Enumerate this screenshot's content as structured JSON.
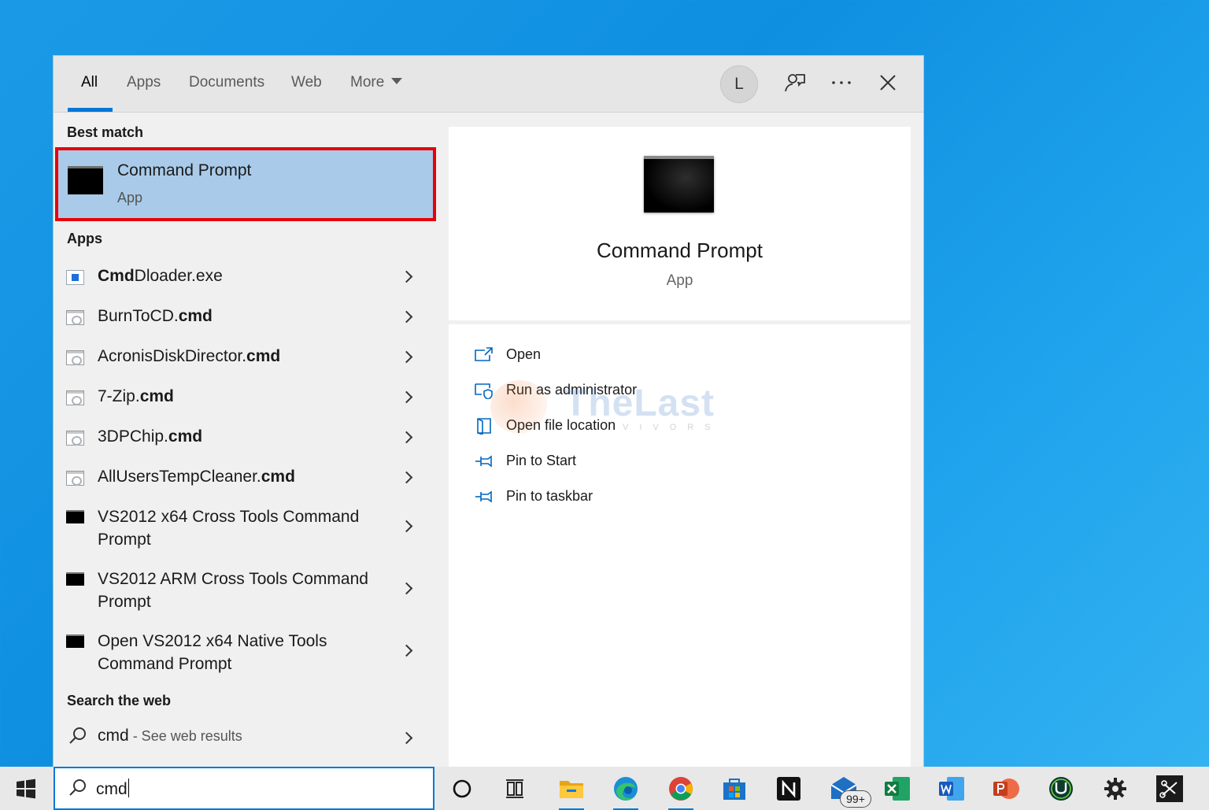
{
  "tabs": [
    {
      "label": "All",
      "active": true
    },
    {
      "label": "Apps",
      "active": false
    },
    {
      "label": "Documents",
      "active": false
    },
    {
      "label": "Web",
      "active": false
    },
    {
      "label": "More",
      "active": false
    }
  ],
  "header": {
    "avatar_letter": "L",
    "icons": [
      "feedback-icon",
      "more-options-icon",
      "close-icon"
    ]
  },
  "best_match": {
    "heading": "Best match",
    "title": "Command Prompt",
    "subtitle": "App",
    "icon": "terminal-icon",
    "highlight_color": "#e8000b"
  },
  "apps": {
    "heading": "Apps",
    "items": [
      {
        "prefix": "Cmd",
        "rest": "Dloader.exe",
        "icon": "exe-icon"
      },
      {
        "prefix": "BurnToCD.",
        "rest": "cmd",
        "icon": "cmd-file-icon"
      },
      {
        "prefix": "AcronisDiskDirector.",
        "rest": "cmd",
        "icon": "cmd-file-icon"
      },
      {
        "prefix": "7-Zip.",
        "rest": "cmd",
        "icon": "cmd-file-icon"
      },
      {
        "prefix": "3DPChip.",
        "rest": "cmd",
        "icon": "cmd-file-icon"
      },
      {
        "prefix": "AllUsersTempCleaner.",
        "rest": "cmd",
        "icon": "cmd-file-icon"
      },
      {
        "line1": "VS2012 x64 Cross Tools Command",
        "line2": "Prompt",
        "icon": "terminal-icon"
      },
      {
        "line1": "VS2012 ARM Cross Tools Command",
        "line2": "Prompt",
        "icon": "terminal-icon"
      },
      {
        "line1": "Open VS2012 x64 Native Tools",
        "line2": "Command Prompt",
        "icon": "terminal-icon"
      }
    ]
  },
  "web": {
    "heading": "Search the web",
    "query": "cmd",
    "suffix": " - See web results"
  },
  "preview": {
    "title": "Command Prompt",
    "subtitle": "App",
    "actions": [
      {
        "label": "Open",
        "icon": "open-icon"
      },
      {
        "label": "Run as administrator",
        "icon": "shield-icon"
      },
      {
        "label": "Open file location",
        "icon": "file-location-icon"
      },
      {
        "label": "Pin to Start",
        "icon": "pin-icon"
      },
      {
        "label": "Pin to taskbar",
        "icon": "pin-icon"
      }
    ]
  },
  "watermark": {
    "text": "TheLast",
    "sub": "VIVORS"
  },
  "taskbar": {
    "search_value": "cmd",
    "mail_badge": "99+",
    "accent": "#0078d7",
    "items": [
      "cortana-icon",
      "task-view-icon",
      "file-explorer-icon",
      "edge-icon",
      "chrome-icon",
      "store-icon",
      "notion-icon",
      "mail-icon",
      "excel-icon",
      "word-icon",
      "powerpoint-icon",
      "upwork-icon",
      "settings-icon",
      "snipping-tool-icon"
    ]
  }
}
